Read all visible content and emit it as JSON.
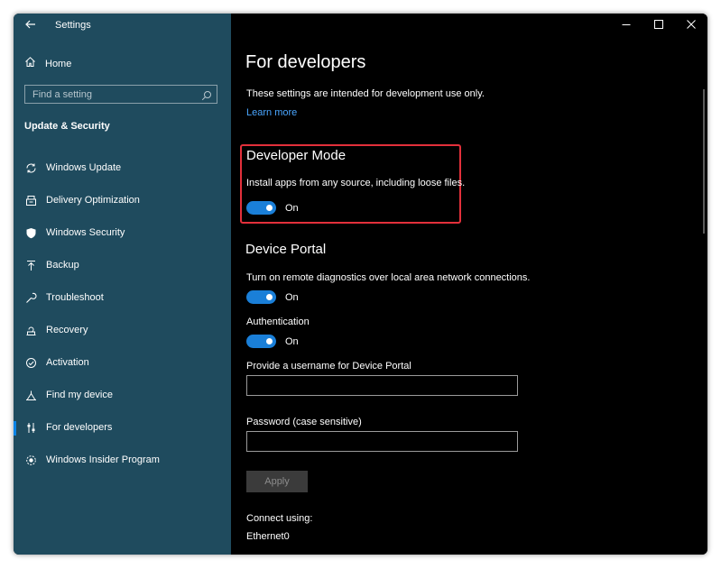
{
  "window": {
    "app_title": "Settings"
  },
  "sidebar": {
    "home_label": "Home",
    "search_placeholder": "Find a setting",
    "section_title": "Update & Security",
    "items": [
      {
        "label": "Windows Update",
        "icon": "refresh-icon"
      },
      {
        "label": "Delivery Optimization",
        "icon": "delivery-optimization-icon"
      },
      {
        "label": "Windows Security",
        "icon": "shield-icon"
      },
      {
        "label": "Backup",
        "icon": "backup-arrow-icon"
      },
      {
        "label": "Troubleshoot",
        "icon": "wrench-icon"
      },
      {
        "label": "Recovery",
        "icon": "recovery-icon"
      },
      {
        "label": "Activation",
        "icon": "activation-check-icon"
      },
      {
        "label": "Find my device",
        "icon": "find-device-icon"
      },
      {
        "label": "For developers",
        "icon": "developer-sliders-icon",
        "selected": true
      },
      {
        "label": "Windows Insider Program",
        "icon": "insider-icon"
      }
    ]
  },
  "main": {
    "title": "For developers",
    "intro": "These settings are intended for development use only.",
    "learn_more": "Learn more",
    "developer_mode": {
      "heading": "Developer Mode",
      "description": "Install apps from any source, including loose files.",
      "toggle_label": "On",
      "toggle_on": true
    },
    "device_portal": {
      "heading": "Device Portal",
      "remote_diag_label": "Turn on remote diagnostics over local area network connections.",
      "remote_diag_toggle": "On",
      "auth_label": "Authentication",
      "auth_toggle": "On",
      "username_label": "Provide a username for Device Portal",
      "username_value": "",
      "password_label": "Password (case sensitive)",
      "password_value": "",
      "apply_label": "Apply",
      "connect_label": "Connect using:",
      "connect_value": "Ethernet0"
    }
  },
  "colors": {
    "sidebar_bg": "#1f4b5e",
    "main_bg": "#000000",
    "accent": "#1a7fd8",
    "link": "#4aa6ff",
    "highlight": "#e3303b"
  }
}
